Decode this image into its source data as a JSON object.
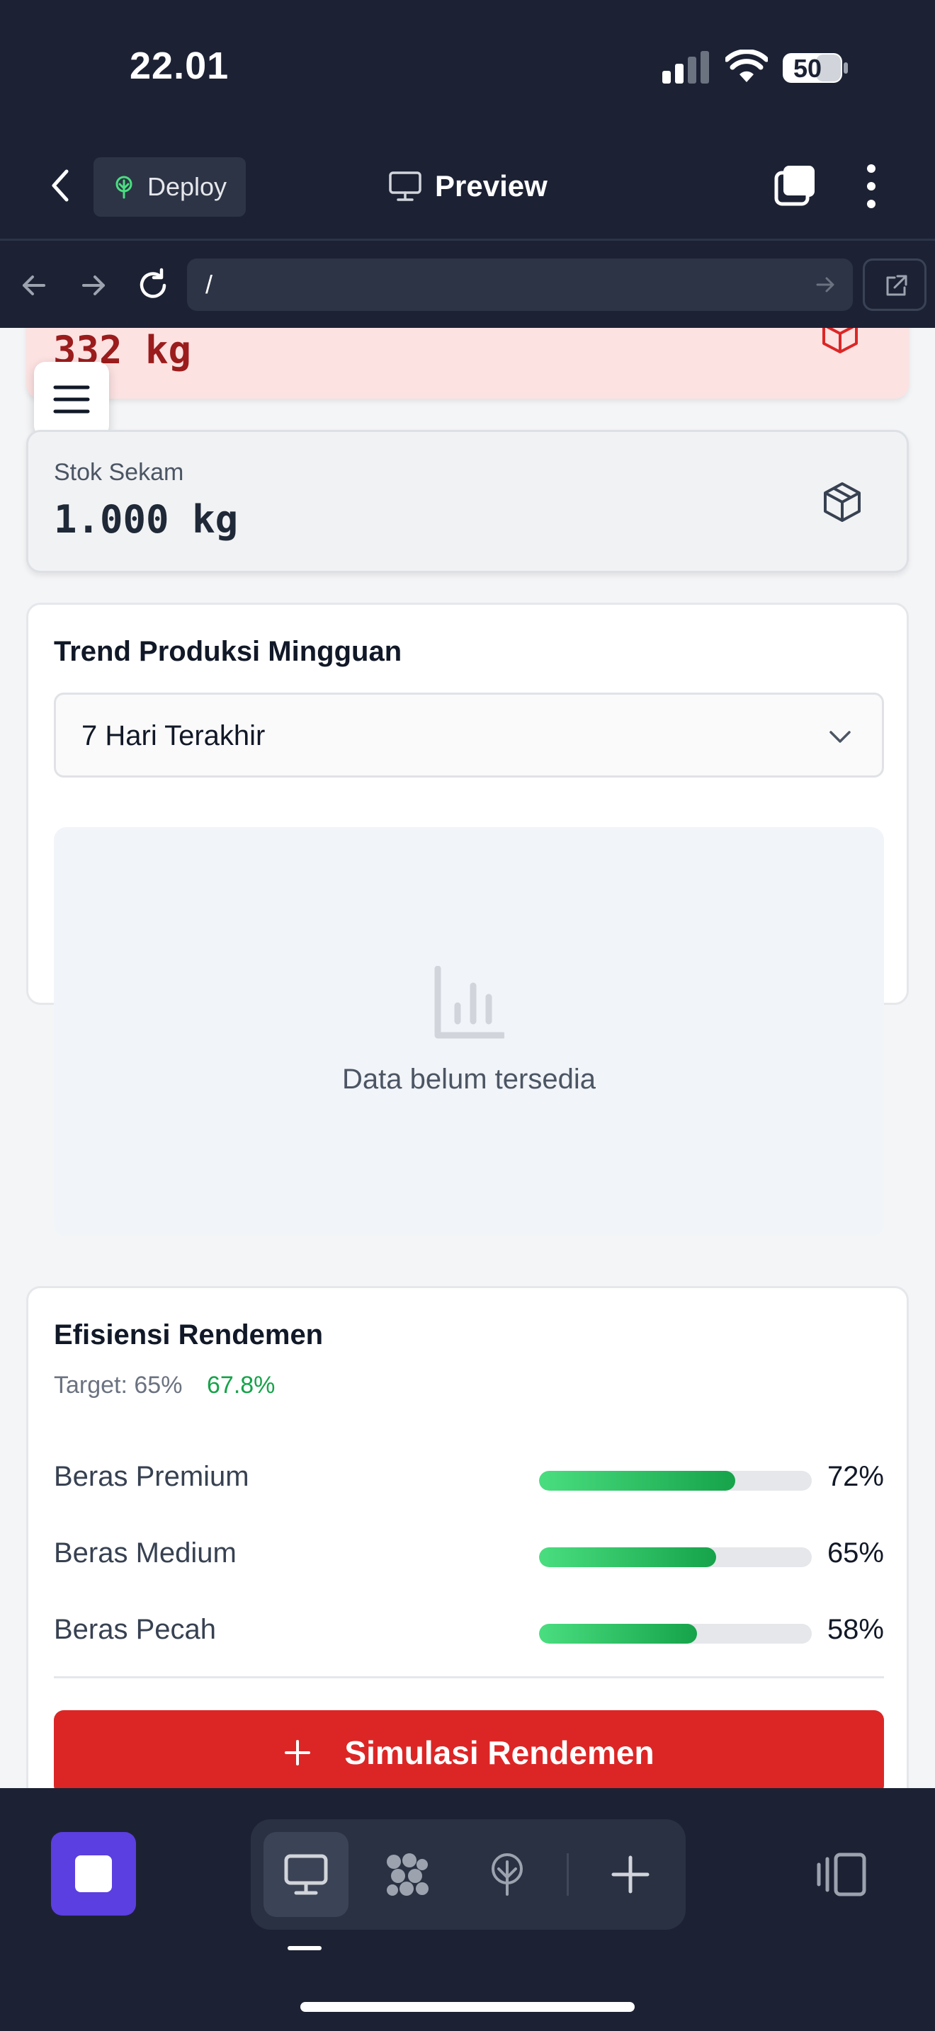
{
  "status_bar": {
    "time": "22.01",
    "battery": "50"
  },
  "header": {
    "deploy_label": "Deploy",
    "title": "Preview"
  },
  "url_bar": {
    "url": "/"
  },
  "cards": {
    "top_value": "332 kg",
    "stock": {
      "label": "Stok Sekam",
      "value": "1.000 kg"
    }
  },
  "trend": {
    "title": "Trend Produksi Mingguan",
    "range_selected": "7 Hari Terakhir",
    "empty_message": "Data belum tersedia"
  },
  "rendemen": {
    "title": "Efisiensi Rendemen",
    "target": "Target: 65%",
    "actual": "67.8%",
    "rows": [
      {
        "name": "Beras Premium",
        "percent": "72%",
        "value": 0.72
      },
      {
        "name": "Beras Medium",
        "percent": "65%",
        "value": 0.65
      },
      {
        "name": "Beras Pecah",
        "percent": "58%",
        "value": 0.58
      }
    ],
    "button_label": "Simulasi Rendemen"
  },
  "colors": {
    "accent_red": "#dc2626",
    "progress_green": "#16a34a",
    "dark_ui": "#1c2234",
    "app_purple": "#5b3fe0"
  },
  "icons": [
    "back-icon",
    "deploy-icon",
    "monitor-icon",
    "tabs-icon",
    "kebab-icon",
    "arrow-left-icon",
    "arrow-right-icon",
    "reload-icon",
    "external-link-icon",
    "box-icon",
    "hamburger-icon",
    "chevron-down-icon",
    "bar-chart-icon",
    "plus-icon",
    "grid-icon",
    "deploy-tree-icon",
    "sidebar-toggle-icon"
  ]
}
